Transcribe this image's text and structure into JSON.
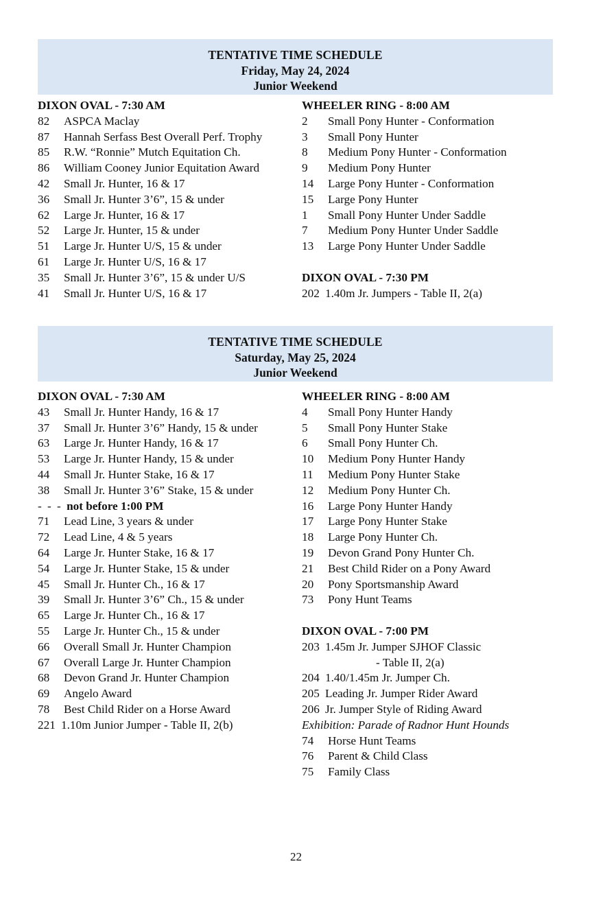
{
  "page": {
    "number": "22"
  },
  "schedules": [
    {
      "band": {
        "title": "TENTATIVE TIME SCHEDULE",
        "date": "Friday, May 24, 2024",
        "subtitle": "Junior Weekend"
      },
      "left_column": [
        {
          "type": "ring_heading",
          "ring": "DIXON OVAL",
          "separator": " - ",
          "time": "7:30 AM"
        },
        {
          "type": "entry",
          "num": "82",
          "desc": "ASPCA Maclay"
        },
        {
          "type": "entry",
          "num": "87",
          "desc": "Hannah Serfass Best Overall Perf. Trophy"
        },
        {
          "type": "entry",
          "num": "85",
          "desc": "R.W. “Ronnie” Mutch Equitation Ch."
        },
        {
          "type": "entry",
          "num": "86",
          "desc": "William Cooney Junior Equitation Award"
        },
        {
          "type": "entry",
          "num": "42",
          "desc": "Small Jr. Hunter, 16 & 17"
        },
        {
          "type": "entry",
          "num": "36",
          "desc": "Small Jr. Hunter 3’6”, 15 & under"
        },
        {
          "type": "entry",
          "num": "62",
          "desc": "Large Jr. Hunter, 16 & 17"
        },
        {
          "type": "entry",
          "num": "52",
          "desc": "Large Jr. Hunter, 15 & under"
        },
        {
          "type": "entry",
          "num": "51",
          "desc": "Large Jr. Hunter U/S, 15 & under"
        },
        {
          "type": "entry",
          "num": "61",
          "desc": "Large Jr. Hunter U/S, 16 & 17"
        },
        {
          "type": "entry",
          "num": "35",
          "desc": "Small Jr. Hunter 3’6”, 15 & under U/S"
        },
        {
          "type": "entry",
          "num": "41",
          "desc": "Small Jr. Hunter U/S, 16 & 17"
        }
      ],
      "right_column": [
        {
          "type": "ring_heading",
          "ring": "WHEELER RING",
          "separator": " - ",
          "time": "8:00 AM"
        },
        {
          "type": "entry",
          "num": "2",
          "desc": "Small Pony Hunter - Conformation"
        },
        {
          "type": "entry",
          "num": "3",
          "desc": "Small Pony Hunter"
        },
        {
          "type": "entry",
          "num": "8",
          "desc": "Medium Pony Hunter - Conformation"
        },
        {
          "type": "entry",
          "num": "9",
          "desc": "Medium Pony Hunter"
        },
        {
          "type": "entry",
          "num": "14",
          "desc": "Large Pony Hunter - Conformation"
        },
        {
          "type": "entry",
          "num": "15",
          "desc": "Large Pony Hunter"
        },
        {
          "type": "entry",
          "num": "1",
          "desc": "Small Pony Hunter Under Saddle"
        },
        {
          "type": "entry",
          "num": "7",
          "desc": "Medium Pony Hunter Under Saddle"
        },
        {
          "type": "entry",
          "num": "13",
          "desc": "Large Pony Hunter Under Saddle"
        },
        {
          "type": "gap"
        },
        {
          "type": "ring_heading",
          "ring": "DIXON OVAL",
          "separator": " - ",
          "time": "7:30 PM"
        },
        {
          "type": "entry3",
          "num": "202",
          "desc": "1.40m Jr. Jumpers - Table II, 2(a)"
        }
      ]
    },
    {
      "band": {
        "title": "TENTATIVE TIME SCHEDULE",
        "date": "Saturday, May 25, 2024",
        "subtitle": "Junior Weekend"
      },
      "left_column": [
        {
          "type": "ring_heading",
          "ring": "DIXON OVAL",
          "separator": " - ",
          "time": "7:30 AM"
        },
        {
          "type": "entry",
          "num": "43",
          "desc": "Small Jr. Hunter Handy, 16 & 17"
        },
        {
          "type": "entry",
          "num": "37",
          "desc": "Small Jr. Hunter 3’6” Handy, 15 & under"
        },
        {
          "type": "entry",
          "num": "63",
          "desc": "Large Jr. Hunter Handy, 16 & 17"
        },
        {
          "type": "entry",
          "num": "53",
          "desc": "Large Jr. Hunter Handy, 15 & under"
        },
        {
          "type": "entry",
          "num": "44",
          "desc": "Small Jr. Hunter Stake, 16 & 17"
        },
        {
          "type": "entry",
          "num": "38",
          "desc": "Small Jr. Hunter 3’6” Stake, 15 & under"
        },
        {
          "type": "note",
          "dashes": "- - - ",
          "text": "not before 1:00 PM"
        },
        {
          "type": "entry",
          "num": "71",
          "desc": "Lead Line, 3 years & under"
        },
        {
          "type": "entry",
          "num": "72",
          "desc": "Lead Line, 4 & 5 years"
        },
        {
          "type": "entry",
          "num": "64",
          "desc": "Large Jr. Hunter Stake, 16 & 17"
        },
        {
          "type": "entry",
          "num": "54",
          "desc": "Large Jr. Hunter Stake, 15 & under"
        },
        {
          "type": "entry",
          "num": "45",
          "desc": "Small Jr. Hunter Ch., 16 & 17"
        },
        {
          "type": "entry",
          "num": "39",
          "desc": "Small Jr. Hunter 3’6” Ch., 15 & under"
        },
        {
          "type": "entry",
          "num": "65",
          "desc": "Large Jr. Hunter Ch., 16 & 17"
        },
        {
          "type": "entry",
          "num": "55",
          "desc": "Large Jr. Hunter Ch., 15 & under"
        },
        {
          "type": "entry",
          "num": "66",
          "desc": "Overall Small Jr. Hunter Champion"
        },
        {
          "type": "entry",
          "num": "67",
          "desc": "Overall Large Jr. Hunter Champion"
        },
        {
          "type": "entry",
          "num": "68",
          "desc": "Devon Grand Jr. Hunter Champion"
        },
        {
          "type": "entry",
          "num": "69",
          "desc": "Angelo Award"
        },
        {
          "type": "entry",
          "num": "78",
          "desc": "Best Child Rider on a Horse Award"
        },
        {
          "type": "entry3",
          "num": "221",
          "desc": "1.10m Junior Jumper - Table II, 2(b)"
        }
      ],
      "right_column": [
        {
          "type": "ring_heading",
          "ring": "WHEELER RING",
          "separator": " - ",
          "time": "8:00 AM"
        },
        {
          "type": "entry",
          "num": "4",
          "desc": "Small Pony Hunter Handy"
        },
        {
          "type": "entry",
          "num": "5",
          "desc": "Small Pony Hunter Stake"
        },
        {
          "type": "entry",
          "num": "6",
          "desc": "Small Pony Hunter Ch."
        },
        {
          "type": "entry",
          "num": "10",
          "desc": "Medium Pony Hunter Handy"
        },
        {
          "type": "entry",
          "num": "11",
          "desc": "Medium Pony Hunter Stake"
        },
        {
          "type": "entry",
          "num": "12",
          "desc": "Medium Pony Hunter Ch."
        },
        {
          "type": "entry",
          "num": "16",
          "desc": "Large Pony Hunter Handy"
        },
        {
          "type": "entry",
          "num": "17",
          "desc": "Large Pony Hunter Stake"
        },
        {
          "type": "entry",
          "num": "18",
          "desc": "Large Pony Hunter Ch."
        },
        {
          "type": "entry",
          "num": "19",
          "desc": "Devon Grand Pony Hunter Ch."
        },
        {
          "type": "entry",
          "num": "21",
          "desc": "Best Child Rider on a Pony Award"
        },
        {
          "type": "entry",
          "num": "20",
          "desc": "Pony Sportsmanship Award"
        },
        {
          "type": "entry",
          "num": "73",
          "desc": "Pony Hunt Teams"
        },
        {
          "type": "gap"
        },
        {
          "type": "ring_heading",
          "ring": "DIXON OVAL",
          "separator": " - ",
          "time": "7:00 PM"
        },
        {
          "type": "entry3",
          "num": "203",
          "desc": "1.45m Jr. Jumper SJHOF Classic"
        },
        {
          "type": "continuation",
          "text": "- Table II, 2(a)"
        },
        {
          "type": "entry3",
          "num": "204",
          "desc": "1.40/1.45m Jr. Jumper Ch."
        },
        {
          "type": "entry3",
          "num": "205",
          "desc": "Leading Jr. Jumper Rider Award"
        },
        {
          "type": "entry3",
          "num": "206",
          "desc": "Jr. Jumper Style of Riding Award"
        },
        {
          "type": "italic",
          "text": "Exhibition: Parade of Radnor Hunt Hounds"
        },
        {
          "type": "entry",
          "num": "74",
          "desc": "Horse Hunt Teams"
        },
        {
          "type": "entry",
          "num": "76",
          "desc": "Parent & Child Class"
        },
        {
          "type": "entry",
          "num": "75",
          "desc": "Family Class"
        }
      ]
    }
  ]
}
